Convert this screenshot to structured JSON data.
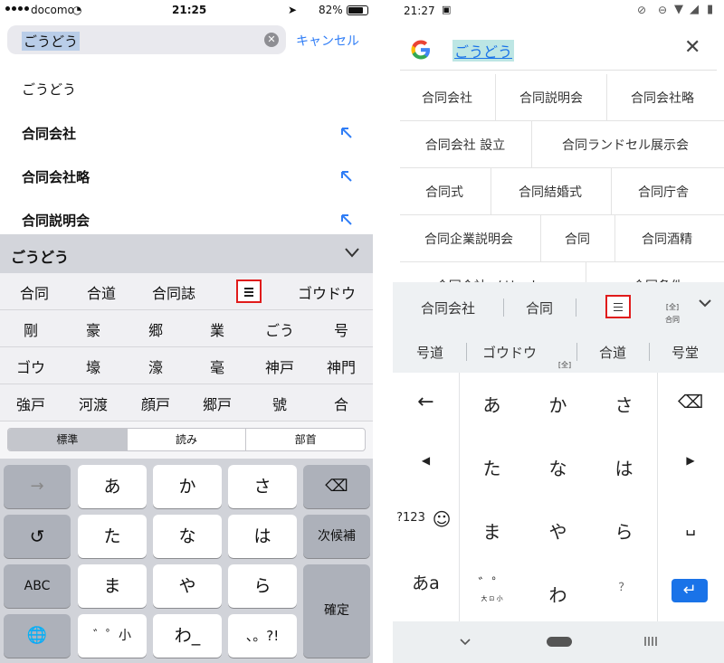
{
  "ios": {
    "status": {
      "carrier": "docomo",
      "time": "21:25",
      "battery": "82%"
    },
    "search": {
      "query": "ごうどう",
      "cancel": "キャンセル"
    },
    "results": [
      {
        "text": "ごうどう",
        "bold": false,
        "arrow": false
      },
      {
        "text": "合同会社",
        "bold": true,
        "arrow": true
      },
      {
        "text": "合同会社略",
        "bold": true,
        "arrow": true
      },
      {
        "text": "合同説明会",
        "bold": true,
        "arrow": true
      }
    ],
    "candidate_header": "ごうどう",
    "candidate_rows": [
      [
        "合同",
        "合道",
        "合同誌",
        "≡",
        "ゴウドウ"
      ],
      [
        "剛",
        "豪",
        "郷",
        "業",
        "ごう",
        "号"
      ],
      [
        "ゴウ",
        "壕",
        "濠",
        "毫",
        "神戸",
        "神門"
      ],
      [
        "強戸",
        "河渡",
        "顔戸",
        "郷戸",
        "號",
        "合"
      ]
    ],
    "segments": [
      "標準",
      "読み",
      "部首"
    ],
    "keyboard": {
      "row1": [
        "→",
        "あ",
        "か",
        "さ",
        "⌫"
      ],
      "row2": [
        "↺",
        "た",
        "な",
        "は",
        "次候補"
      ],
      "row3": [
        "ABC",
        "ま",
        "や",
        "ら"
      ],
      "row4": [
        "🌐",
        "゛゜小",
        "わ_",
        "、。?!"
      ],
      "enter": "確定"
    }
  },
  "android": {
    "status": {
      "time": "21:27"
    },
    "query": "ごうどう",
    "close": "✕",
    "suggestions": [
      [
        "合同会社",
        "合同説明会",
        "合同会社略"
      ],
      [
        "合同会社 設立",
        "合同ランドセル展示会"
      ],
      [
        "合同式",
        "合同結婚式",
        "合同庁舎"
      ],
      [
        "合同企業説明会",
        "合同",
        "合同酒精"
      ],
      [
        "合同会社 メリット",
        "合同条件"
      ]
    ],
    "candidates_row1": [
      "合同会社",
      "合同",
      "≡",
      "[全]",
      "合同"
    ],
    "candidates_row2": [
      "号道",
      "ゴウドウ",
      "[全]",
      "合道",
      "号堂"
    ],
    "keys": {
      "row1": [
        "あ",
        "か",
        "さ"
      ],
      "row2": [
        "た",
        "な",
        "は"
      ],
      "row3": [
        "ま",
        "や",
        "ら"
      ],
      "row4": [
        "わ"
      ],
      "left": [
        "←",
        "◀",
        "?123",
        "あa"
      ],
      "right": [
        "⌫",
        "▶",
        "␣",
        "↵"
      ],
      "dakuten": "゛゜",
      "dakuten_sub": "大 ⊡ 小",
      "punct": "？",
      "emoji": "☺"
    }
  }
}
